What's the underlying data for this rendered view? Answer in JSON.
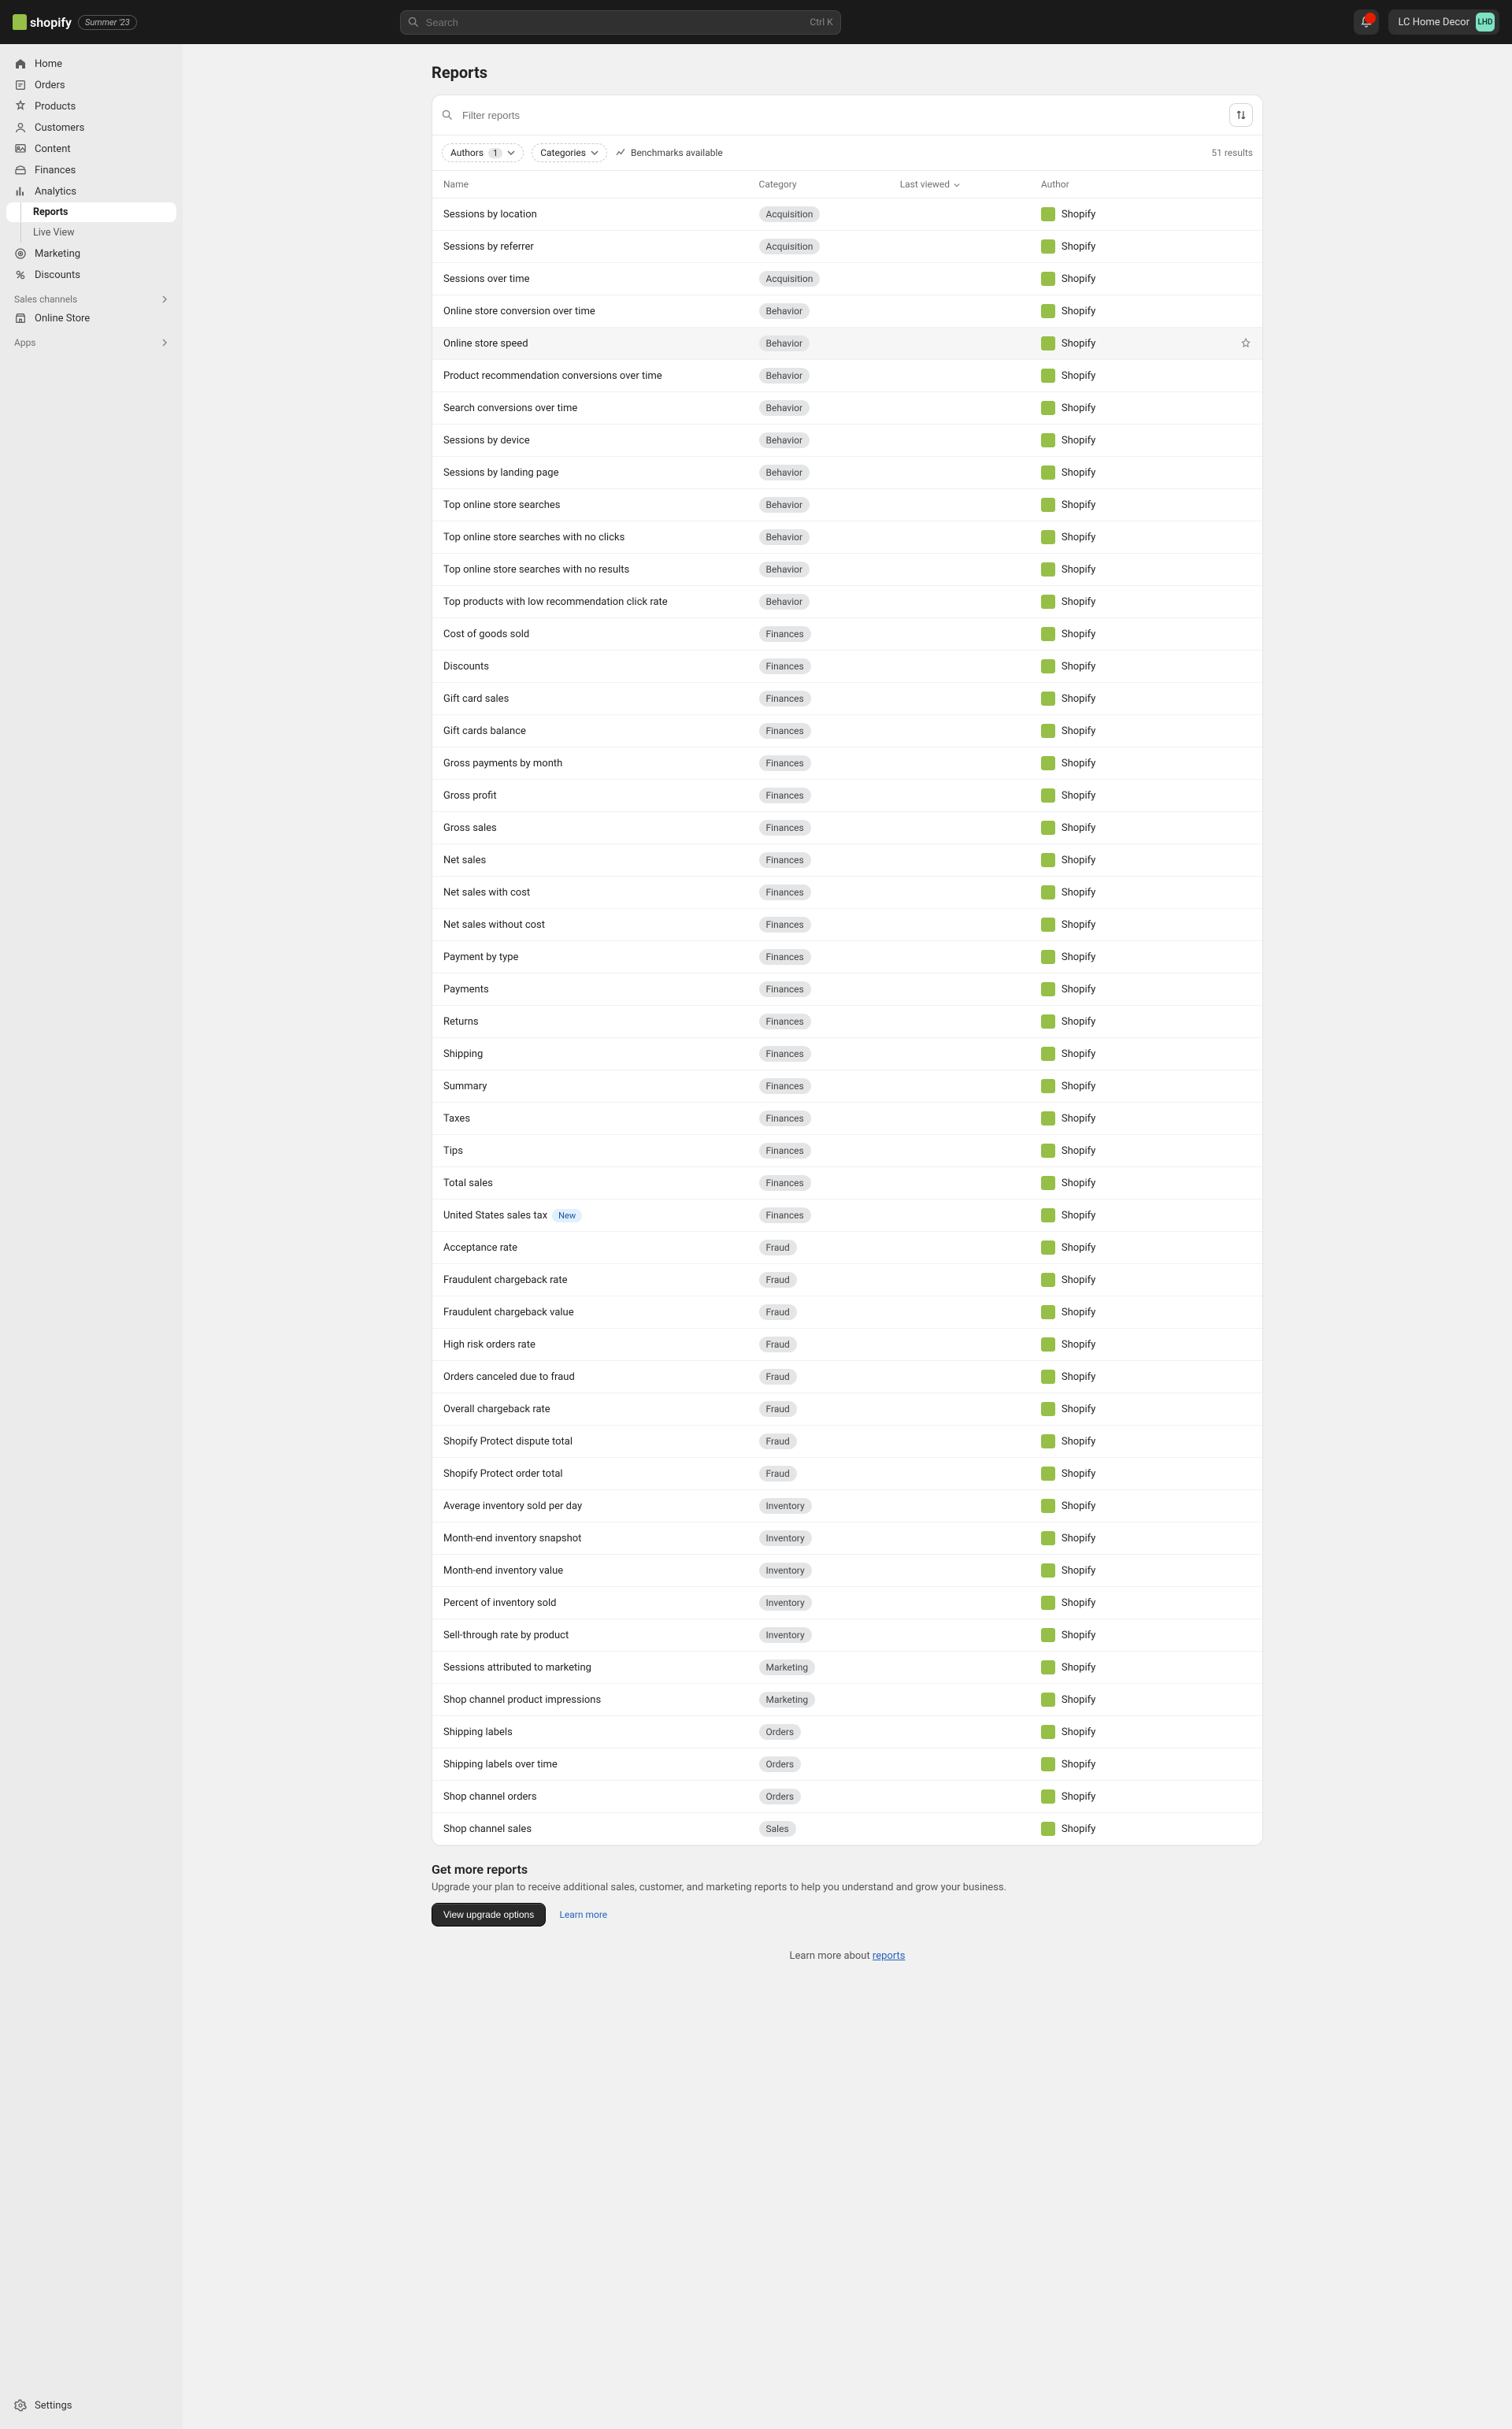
{
  "topbar": {
    "brand": "shopify",
    "edition": "Summer '23",
    "search_placeholder": "Search",
    "search_shortcut": "Ctrl K",
    "notifications_count": "",
    "store_name": "LC Home Decor",
    "avatar_initials": "LHD"
  },
  "sidebar": {
    "items": [
      {
        "label": "Home",
        "icon": "home-icon"
      },
      {
        "label": "Orders",
        "icon": "orders-icon"
      },
      {
        "label": "Products",
        "icon": "products-icon"
      },
      {
        "label": "Customers",
        "icon": "customers-icon"
      },
      {
        "label": "Content",
        "icon": "content-icon"
      },
      {
        "label": "Finances",
        "icon": "finances-icon"
      },
      {
        "label": "Analytics",
        "icon": "analytics-icon"
      }
    ],
    "analytics_sub": [
      {
        "label": "Reports",
        "active": true
      },
      {
        "label": "Live View",
        "active": false
      }
    ],
    "items2": [
      {
        "label": "Marketing",
        "icon": "marketing-icon"
      },
      {
        "label": "Discounts",
        "icon": "discounts-icon"
      }
    ],
    "sales_channels_label": "Sales channels",
    "sales_channels": [
      {
        "label": "Online Store",
        "icon": "store-icon"
      }
    ],
    "apps_label": "Apps",
    "settings_label": "Settings"
  },
  "page": {
    "title": "Reports",
    "filter_placeholder": "Filter reports",
    "authors_label": "Authors",
    "authors_count": "1",
    "categories_label": "Categories",
    "benchmarks_label": "Benchmarks available",
    "results_text": "51 results",
    "columns": {
      "name": "Name",
      "category": "Category",
      "last_viewed": "Last viewed",
      "author": "Author"
    }
  },
  "reports": [
    {
      "name": "Sessions by location",
      "category": "Acquisition",
      "author": "Shopify"
    },
    {
      "name": "Sessions by referrer",
      "category": "Acquisition",
      "author": "Shopify"
    },
    {
      "name": "Sessions over time",
      "category": "Acquisition",
      "author": "Shopify"
    },
    {
      "name": "Online store conversion over time",
      "category": "Behavior",
      "author": "Shopify"
    },
    {
      "name": "Online store speed",
      "category": "Behavior",
      "author": "Shopify",
      "hovered": true,
      "pin": true
    },
    {
      "name": "Product recommendation conversions over time",
      "category": "Behavior",
      "author": "Shopify"
    },
    {
      "name": "Search conversions over time",
      "category": "Behavior",
      "author": "Shopify"
    },
    {
      "name": "Sessions by device",
      "category": "Behavior",
      "author": "Shopify"
    },
    {
      "name": "Sessions by landing page",
      "category": "Behavior",
      "author": "Shopify"
    },
    {
      "name": "Top online store searches",
      "category": "Behavior",
      "author": "Shopify"
    },
    {
      "name": "Top online store searches with no clicks",
      "category": "Behavior",
      "author": "Shopify"
    },
    {
      "name": "Top online store searches with no results",
      "category": "Behavior",
      "author": "Shopify"
    },
    {
      "name": "Top products with low recommendation click rate",
      "category": "Behavior",
      "author": "Shopify"
    },
    {
      "name": "Cost of goods sold",
      "category": "Finances",
      "author": "Shopify"
    },
    {
      "name": "Discounts",
      "category": "Finances",
      "author": "Shopify"
    },
    {
      "name": "Gift card sales",
      "category": "Finances",
      "author": "Shopify"
    },
    {
      "name": "Gift cards balance",
      "category": "Finances",
      "author": "Shopify"
    },
    {
      "name": "Gross payments by month",
      "category": "Finances",
      "author": "Shopify"
    },
    {
      "name": "Gross profit",
      "category": "Finances",
      "author": "Shopify"
    },
    {
      "name": "Gross sales",
      "category": "Finances",
      "author": "Shopify"
    },
    {
      "name": "Net sales",
      "category": "Finances",
      "author": "Shopify"
    },
    {
      "name": "Net sales with cost",
      "category": "Finances",
      "author": "Shopify"
    },
    {
      "name": "Net sales without cost",
      "category": "Finances",
      "author": "Shopify"
    },
    {
      "name": "Payment by type",
      "category": "Finances",
      "author": "Shopify"
    },
    {
      "name": "Payments",
      "category": "Finances",
      "author": "Shopify"
    },
    {
      "name": "Returns",
      "category": "Finances",
      "author": "Shopify"
    },
    {
      "name": "Shipping",
      "category": "Finances",
      "author": "Shopify"
    },
    {
      "name": "Summary",
      "category": "Finances",
      "author": "Shopify"
    },
    {
      "name": "Taxes",
      "category": "Finances",
      "author": "Shopify"
    },
    {
      "name": "Tips",
      "category": "Finances",
      "author": "Shopify"
    },
    {
      "name": "Total sales",
      "category": "Finances",
      "author": "Shopify"
    },
    {
      "name": "United States sales tax",
      "category": "Finances",
      "author": "Shopify",
      "new": true
    },
    {
      "name": "Acceptance rate",
      "category": "Fraud",
      "author": "Shopify"
    },
    {
      "name": "Fraudulent chargeback rate",
      "category": "Fraud",
      "author": "Shopify"
    },
    {
      "name": "Fraudulent chargeback value",
      "category": "Fraud",
      "author": "Shopify"
    },
    {
      "name": "High risk orders rate",
      "category": "Fraud",
      "author": "Shopify"
    },
    {
      "name": "Orders canceled due to fraud",
      "category": "Fraud",
      "author": "Shopify"
    },
    {
      "name": "Overall chargeback rate",
      "category": "Fraud",
      "author": "Shopify"
    },
    {
      "name": "Shopify Protect dispute total",
      "category": "Fraud",
      "author": "Shopify"
    },
    {
      "name": "Shopify Protect order total",
      "category": "Fraud",
      "author": "Shopify"
    },
    {
      "name": "Average inventory sold per day",
      "category": "Inventory",
      "author": "Shopify"
    },
    {
      "name": "Month-end inventory snapshot",
      "category": "Inventory",
      "author": "Shopify"
    },
    {
      "name": "Month-end inventory value",
      "category": "Inventory",
      "author": "Shopify"
    },
    {
      "name": "Percent of inventory sold",
      "category": "Inventory",
      "author": "Shopify"
    },
    {
      "name": "Sell-through rate by product",
      "category": "Inventory",
      "author": "Shopify"
    },
    {
      "name": "Sessions attributed to marketing",
      "category": "Marketing",
      "author": "Shopify"
    },
    {
      "name": "Shop channel product impressions",
      "category": "Marketing",
      "author": "Shopify"
    },
    {
      "name": "Shipping labels",
      "category": "Orders",
      "author": "Shopify"
    },
    {
      "name": "Shipping labels over time",
      "category": "Orders",
      "author": "Shopify"
    },
    {
      "name": "Shop channel orders",
      "category": "Orders",
      "author": "Shopify"
    },
    {
      "name": "Shop channel sales",
      "category": "Sales",
      "author": "Shopify"
    }
  ],
  "upsell": {
    "title": "Get more reports",
    "text": "Upgrade your plan to receive additional sales, customer, and marketing reports to help you understand and grow your business.",
    "button": "View upgrade options",
    "link": "Learn more"
  },
  "footer": {
    "prefix": "Learn more about ",
    "link": "reports"
  }
}
